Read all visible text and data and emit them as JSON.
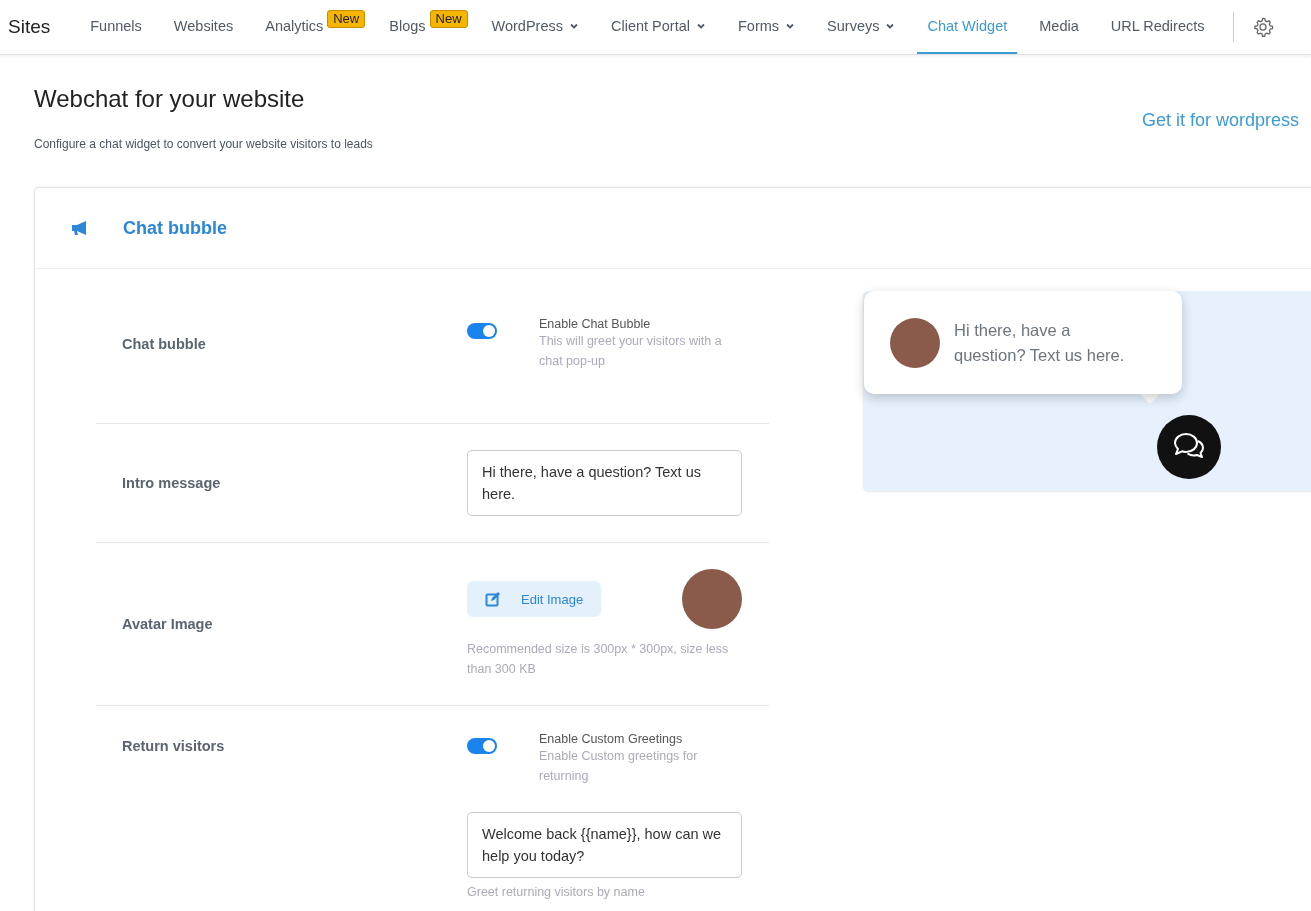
{
  "nav": {
    "brand": "Sites",
    "items": [
      {
        "label": "Funnels",
        "selected": false
      },
      {
        "label": "Websites",
        "selected": false
      },
      {
        "label": "Analytics",
        "badge": "New",
        "selected": false
      },
      {
        "label": "Blogs",
        "badge": "New",
        "selected": false
      },
      {
        "label": "WordPress",
        "dropdown": true,
        "selected": false
      },
      {
        "label": "Client Portal",
        "dropdown": true,
        "selected": false
      },
      {
        "label": "Forms",
        "dropdown": true,
        "selected": false
      },
      {
        "label": "Surveys",
        "dropdown": true,
        "selected": false
      },
      {
        "label": "Chat Widget",
        "selected": true
      },
      {
        "label": "Media",
        "selected": false
      },
      {
        "label": "URL Redirects",
        "selected": false
      }
    ]
  },
  "header": {
    "title": "Webchat for your website",
    "subtitle": "Configure a chat widget to convert your website visitors to leads",
    "link": "Get it for wordpress"
  },
  "card": {
    "title": "Chat bubble",
    "rows": [
      {
        "label": "Chat bubble",
        "controls": [
          {
            "kind": "toggle",
            "on": true,
            "title": "Enable Chat Bubble",
            "description": "This will greet your visitors with a chat pop-up"
          }
        ]
      },
      {
        "label": "Intro message",
        "controls": [
          {
            "kind": "text",
            "value": "Hi there, have a question? Text us here."
          }
        ]
      },
      {
        "label": "Avatar Image",
        "controls": [
          {
            "kind": "image",
            "button": "Edit Image",
            "hint": "Recommended size is 300px * 300px, size less than 300 KB"
          }
        ]
      },
      {
        "label": "Return visitors",
        "controls": [
          {
            "kind": "toggle",
            "on": true,
            "title": "Enable Custom Greetings",
            "description": "Enable Custom greetings for returning"
          },
          {
            "kind": "text",
            "value": "Welcome back {{name}}, how can we help you today?",
            "hint": "Greet returning visitors by name"
          }
        ]
      }
    ],
    "preview": {
      "message": "Hi there, have a question? Text us here."
    }
  }
}
